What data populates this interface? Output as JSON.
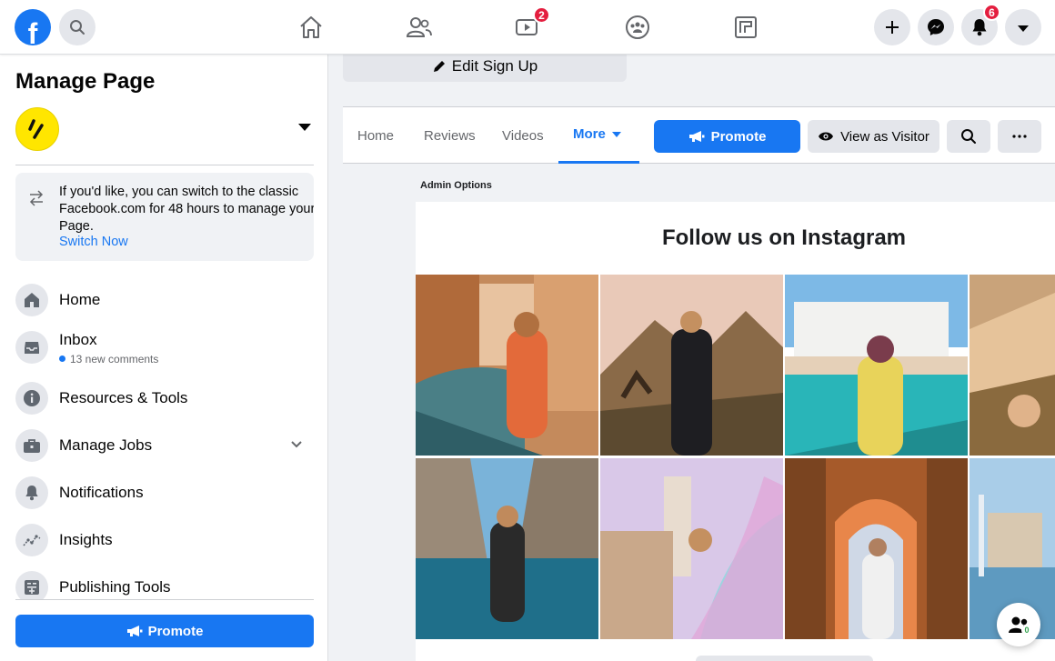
{
  "topbar": {
    "logo_letter": "f",
    "nav": [
      "home-icon",
      "friends-icon",
      "watch-icon",
      "groups-icon",
      "gaming-icon"
    ],
    "watch_badge": "2",
    "notifications_badge": "6"
  },
  "sidebar": {
    "title": "Manage Page",
    "switch_notice": {
      "line1": "If you'd like, you can switch to the classic",
      "line2": "Facebook.com for 48 hours to manage your",
      "line3": "Page.",
      "link": "Switch Now"
    },
    "items": [
      {
        "label": "Home",
        "icon": "home-icon"
      },
      {
        "label": "Inbox",
        "sub": "13 new comments",
        "icon": "inbox-icon"
      },
      {
        "label": "Resources & Tools",
        "icon": "info-icon"
      },
      {
        "label": "Manage Jobs",
        "icon": "briefcase-icon"
      },
      {
        "label": "Notifications",
        "icon": "bell-icon"
      },
      {
        "label": "Insights",
        "icon": "insights-icon"
      },
      {
        "label": "Publishing Tools",
        "icon": "publishing-icon"
      }
    ],
    "promote_label": "Promote"
  },
  "main": {
    "edit_signup_label": "Edit Sign Up",
    "tabs": [
      "Home",
      "Reviews",
      "Videos",
      "More"
    ],
    "promote_label": "Promote",
    "view_as_visitor_label": "View as Visitor",
    "admin_options_label": "Admin Options",
    "instagram_title": "Follow us on Instagram",
    "colors": {
      "accent": "#1877f2",
      "badge": "#e41e3f"
    }
  }
}
